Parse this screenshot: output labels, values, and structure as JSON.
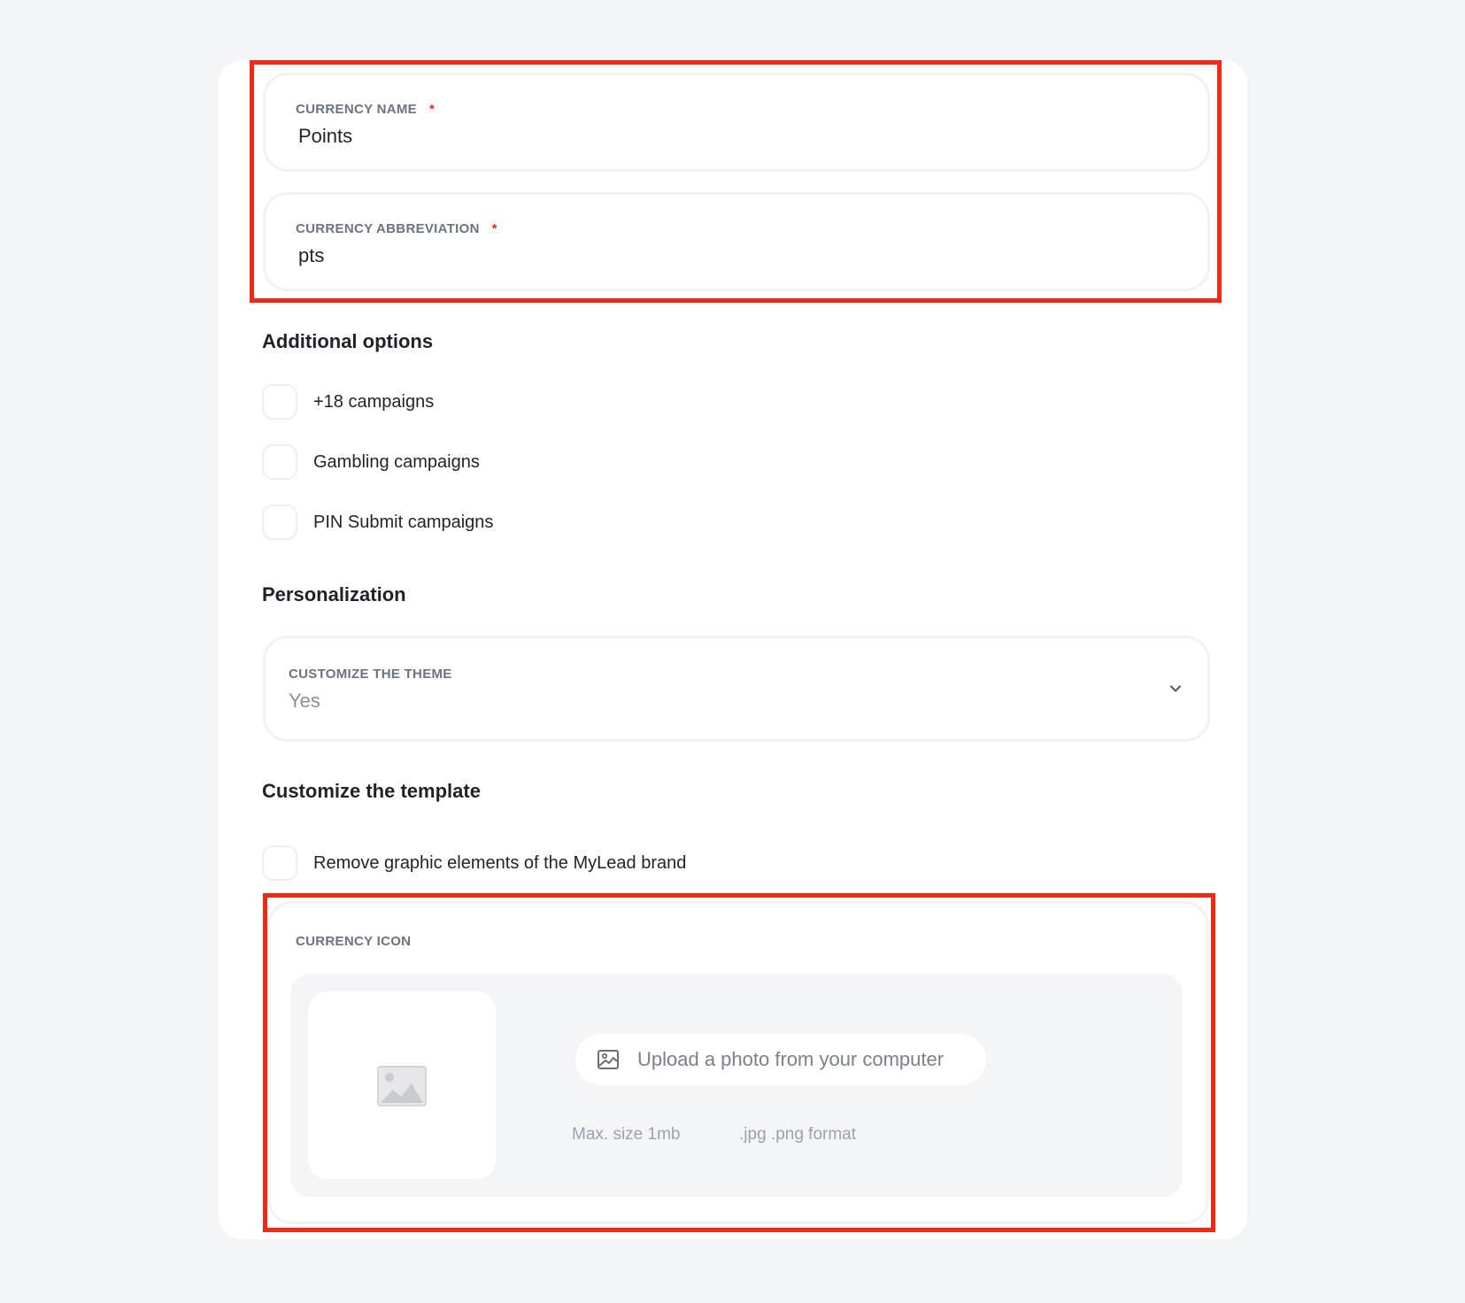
{
  "currency_name": {
    "label": "CURRENCY NAME",
    "required_mark": "*",
    "value": "Points"
  },
  "currency_abbreviation": {
    "label": "CURRENCY ABBREVIATION",
    "required_mark": "*",
    "value": "pts"
  },
  "additional_options": {
    "title": "Additional options",
    "items": [
      {
        "label": "+18 campaigns",
        "checked": false
      },
      {
        "label": "Gambling campaigns",
        "checked": false
      },
      {
        "label": "PIN Submit campaigns",
        "checked": false
      }
    ]
  },
  "personalization": {
    "title": "Personalization",
    "theme_select": {
      "label": "CUSTOMIZE THE THEME",
      "value": "Yes",
      "icon": "chevron-down-icon"
    }
  },
  "customize_template": {
    "title": "Customize the template",
    "remove_branding": {
      "label": "Remove graphic elements of the MyLead brand",
      "checked": false
    }
  },
  "currency_icon": {
    "label": "CURRENCY ICON",
    "placeholder_icon": "image-placeholder-icon",
    "upload_button": {
      "label": "Upload a photo from your computer",
      "icon": "image-icon"
    },
    "max_size": "Max. size 1mb",
    "format": ".jpg .png format"
  },
  "colors": {
    "highlight": "#f22a13",
    "required": "#ef2b1b",
    "page_bg": "#f4f5f8"
  }
}
